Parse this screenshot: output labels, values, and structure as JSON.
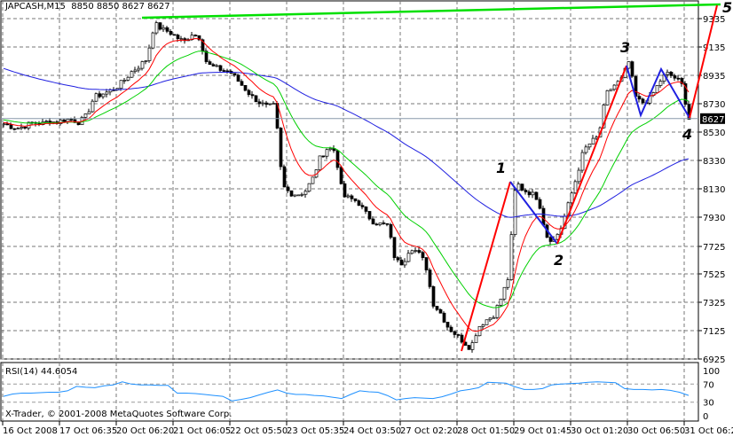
{
  "header": {
    "symbol": "JAPCASH,M15",
    "ohlc": "8850 8850 8627 8627"
  },
  "rsi": {
    "title": "RSI(14) 44.6054",
    "levels": [
      "100",
      "70",
      "30",
      "0"
    ],
    "values": [
      43,
      48,
      50,
      50,
      51,
      52,
      52,
      55,
      65,
      63,
      62,
      66,
      68,
      75,
      70,
      68,
      68,
      67,
      67,
      50,
      50,
      49,
      47,
      45,
      43,
      33,
      36,
      40,
      46,
      52,
      57,
      50,
      47,
      47,
      45,
      44,
      41,
      38,
      47,
      55,
      53,
      52,
      45,
      35,
      38,
      40,
      39,
      38,
      42,
      48,
      55,
      58,
      62,
      74,
      73,
      72,
      64,
      58,
      58,
      60,
      68,
      70,
      71,
      72,
      74,
      75,
      74,
      73,
      60,
      58,
      58,
      57,
      58,
      56,
      52,
      45
    ]
  },
  "copyright": "X-Trader, © 2001-2008 MetaQuotes Software Corp.",
  "price_axis": {
    "labels": [
      "9335",
      "9135",
      "8935",
      "8730",
      "8530",
      "8330",
      "8130",
      "7930",
      "7725",
      "7525",
      "7325",
      "7125",
      "6925"
    ],
    "current": "8627"
  },
  "time_axis": {
    "labels": [
      "16 Oct 2008",
      "17 Oct 06:35",
      "20 Oct 06:20",
      "21 Oct 06:05",
      "22 Oct 05:50",
      "23 Oct 05:35",
      "24 Oct 03:50",
      "27 Oct 02:20",
      "28 Oct 01:50",
      "29 Oct 01:45",
      "30 Oct 01:20",
      "30 Oct 06:50",
      "31 Oct 06:20"
    ]
  },
  "waves": {
    "w1": "1",
    "w2": "2",
    "w3": "3",
    "w4": "4",
    "w5": "5"
  },
  "colors": {
    "fast_ma": "#ff0000",
    "mid_ma": "#00d000",
    "slow_ma": "#2020e0",
    "rsi": "#1e90ff",
    "trend": "#00e000"
  },
  "chart_data": {
    "type": "candlestick",
    "title": "JAPCASH,M15",
    "ylim": [
      6925,
      9400
    ],
    "closes": [
      8590,
      8570,
      8560,
      8580,
      8600,
      8590,
      8610,
      8600,
      8620,
      8620,
      8600,
      8650,
      8780,
      8800,
      8820,
      8850,
      8900,
      8960,
      9000,
      9050,
      9300,
      9260,
      9240,
      9200,
      9170,
      9230,
      9200,
      9010,
      8990,
      8970,
      8960,
      8900,
      8840,
      8780,
      8740,
      8710,
      8720,
      8150,
      8100,
      8090,
      8110,
      8200,
      8350,
      8420,
      8400,
      8080,
      8060,
      8040,
      7960,
      7900,
      7880,
      7870,
      7620,
      7600,
      7720,
      7680,
      7600,
      7320,
      7250,
      7150,
      7100,
      7050,
      7000,
      7150,
      7200,
      7230,
      7350,
      7500,
      8180,
      8120,
      8100,
      8060,
      7800,
      7760,
      7850,
      8020,
      8200,
      8400,
      8460,
      8500,
      8800,
      8860,
      8900,
      9030,
      8760,
      8740,
      8780,
      8880,
      8950,
      8920,
      8880,
      8627
    ]
  }
}
